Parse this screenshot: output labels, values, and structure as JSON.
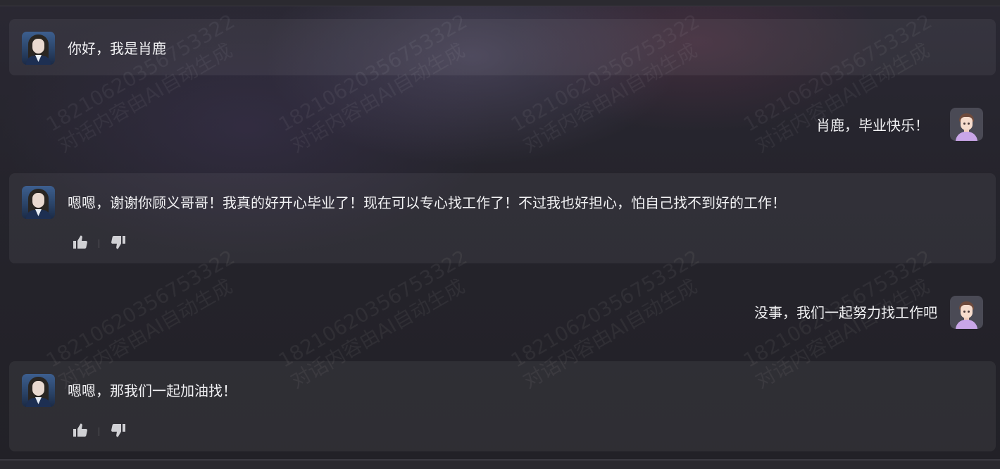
{
  "watermark": {
    "line1": "18210620356753322",
    "line2": "对话内容由AI自动生成"
  },
  "messages": [
    {
      "role": "bot",
      "text": "你好，我是肖鹿",
      "avatar_icon": "girl-avatar-icon"
    },
    {
      "role": "user",
      "text": "肖鹿，毕业快乐！",
      "avatar_icon": "boy-avatar-icon"
    },
    {
      "role": "bot",
      "text": "嗯嗯，谢谢你顾义哥哥！我真的好开心毕业了！现在可以专心找工作了！不过我也好担心，怕自己找不到好的工作！",
      "avatar_icon": "girl-avatar-icon",
      "actions": [
        "thumbs-up-icon",
        "thumbs-down-icon"
      ]
    },
    {
      "role": "user",
      "text": "没事，我们一起努力找工作吧",
      "avatar_icon": "boy-avatar-icon"
    },
    {
      "role": "bot",
      "text": "嗯嗯，那我们一起加油找！",
      "avatar_icon": "girl-avatar-icon",
      "actions": [
        "thumbs-up-icon",
        "thumbs-down-icon"
      ]
    }
  ],
  "colors": {
    "background": "#232229",
    "text": "#f2f2f4",
    "action_icon": "#d0d0d4",
    "user_avatar_bg": "#4a4a55"
  }
}
